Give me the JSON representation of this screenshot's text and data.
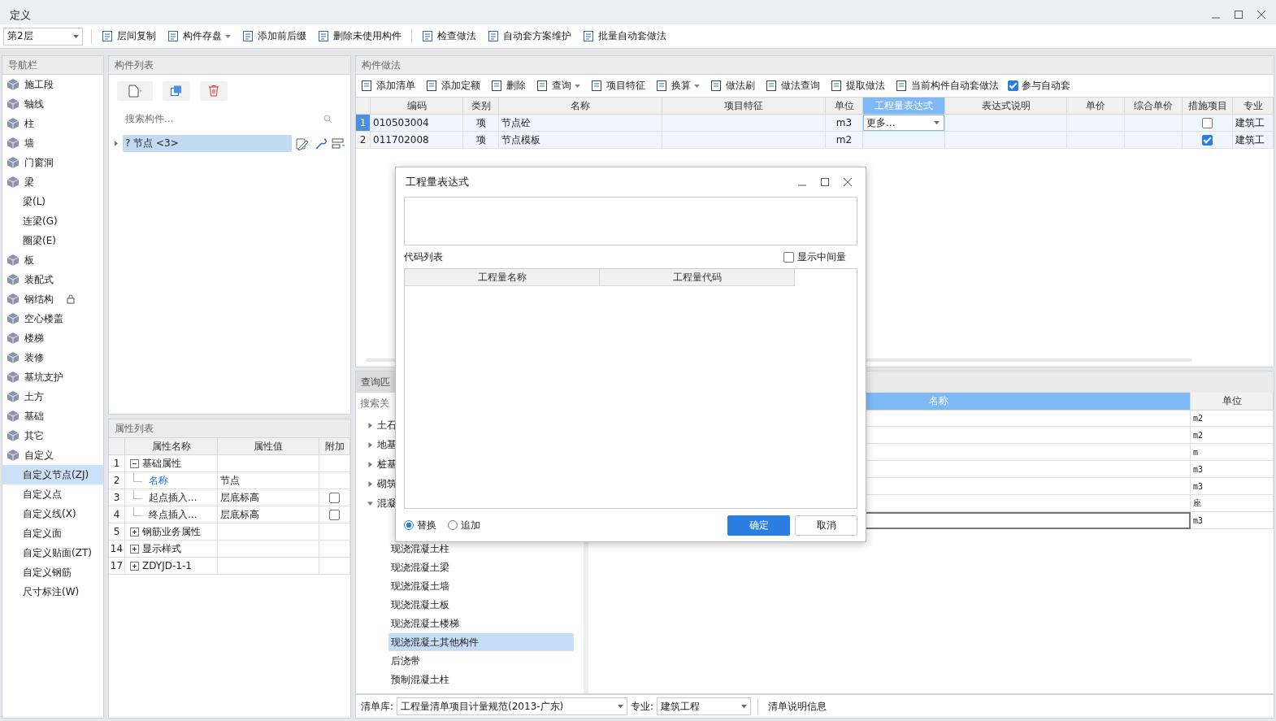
{
  "window": {
    "title": "定义"
  },
  "toolbar": {
    "floor": "第2层",
    "groups": [
      [
        {
          "label": "层间复制",
          "dropdown": false
        },
        {
          "label": "构件存盘",
          "dropdown": true
        },
        {
          "label": "添加前后缀",
          "dropdown": false
        },
        {
          "label": "删除未使用构件",
          "dropdown": false
        }
      ],
      [
        {
          "label": "检查做法",
          "dropdown": false
        },
        {
          "label": "自动套方案维护",
          "dropdown": false
        },
        {
          "label": "批量自动套做法",
          "dropdown": false
        }
      ]
    ]
  },
  "nav": {
    "title": "导航栏",
    "items": [
      {
        "label": "施工段",
        "selected": false,
        "locked": false
      },
      {
        "label": "轴线",
        "selected": false,
        "locked": false
      },
      {
        "label": "柱",
        "selected": false,
        "locked": false
      },
      {
        "label": "墙",
        "selected": false,
        "locked": false
      },
      {
        "label": "门窗洞",
        "selected": false,
        "locked": false
      },
      {
        "label": "梁",
        "selected": false,
        "locked": false,
        "children": [
          {
            "label": "梁(L)",
            "selected": false
          },
          {
            "label": "连梁(G)",
            "selected": false
          },
          {
            "label": "圈梁(E)",
            "selected": false
          }
        ]
      },
      {
        "label": "板",
        "selected": false,
        "locked": false
      },
      {
        "label": "装配式",
        "selected": false,
        "locked": false
      },
      {
        "label": "钢结构",
        "selected": false,
        "locked": true
      },
      {
        "label": "空心楼盖",
        "selected": false,
        "locked": false
      },
      {
        "label": "楼梯",
        "selected": false,
        "locked": false
      },
      {
        "label": "装修",
        "selected": false,
        "locked": false
      },
      {
        "label": "基坑支护",
        "selected": false,
        "locked": false
      },
      {
        "label": "土方",
        "selected": false,
        "locked": false
      },
      {
        "label": "基础",
        "selected": false,
        "locked": false
      },
      {
        "label": "其它",
        "selected": false,
        "locked": false
      },
      {
        "label": "自定义",
        "selected": false,
        "locked": false,
        "children": [
          {
            "label": "自定义节点(ZJ)",
            "selected": true
          },
          {
            "label": "自定义点",
            "selected": false
          },
          {
            "label": "自定义线(X)",
            "selected": false
          },
          {
            "label": "自定义面",
            "selected": false
          },
          {
            "label": "自定义贴面(ZT)",
            "selected": false
          },
          {
            "label": "自定义钢筋",
            "selected": false
          },
          {
            "label": "尺寸标注(W)",
            "selected": false
          }
        ]
      }
    ]
  },
  "component_list": {
    "title": "构件列表",
    "search_placeholder": "搜索构件...",
    "tree": [
      {
        "label": "? 节点 <3>",
        "selected": true,
        "expanded": false
      }
    ]
  },
  "properties": {
    "title": "属性列表",
    "columns": [
      "属性名称",
      "属性值",
      "附加"
    ],
    "rows": [
      {
        "num": "1",
        "kind": "group",
        "name": "基础属性",
        "expanded": true
      },
      {
        "num": "2",
        "kind": "child",
        "name": "名称",
        "value": "节点",
        "highlighted": true
      },
      {
        "num": "3",
        "kind": "child",
        "name": "起点插入...",
        "value": "层底标高",
        "highlighted": false,
        "attached": false
      },
      {
        "num": "4",
        "kind": "child",
        "name": "终点插入...",
        "value": "层底标高",
        "highlighted": false,
        "attached": false
      },
      {
        "num": "5",
        "kind": "group",
        "name": "钢筋业务属性",
        "expanded": false
      },
      {
        "num": "14",
        "kind": "group",
        "name": "显示样式",
        "expanded": false
      },
      {
        "num": "17",
        "kind": "group",
        "name": "ZDYJD-1-1",
        "expanded": false
      }
    ]
  },
  "methods": {
    "title": "构件做法",
    "tools": [
      {
        "label": "添加清单",
        "dropdown": false
      },
      {
        "label": "添加定额",
        "dropdown": false
      },
      {
        "label": "删除",
        "dropdown": false
      },
      {
        "label": "查询",
        "dropdown": true
      },
      {
        "label": "项目特征",
        "dropdown": false
      },
      {
        "label": "换算",
        "dropdown": true
      },
      {
        "label": "做法刷",
        "dropdown": false
      },
      {
        "label": "做法查询",
        "dropdown": false
      },
      {
        "label": "提取做法",
        "dropdown": false
      },
      {
        "label": "当前构件自动套做法",
        "dropdown": false
      }
    ],
    "auto_apply": {
      "label": "参与自动套",
      "checked": true
    },
    "columns": [
      {
        "label": "编码",
        "selected": false
      },
      {
        "label": "类别",
        "selected": false
      },
      {
        "label": "名称",
        "selected": false
      },
      {
        "label": "项目特征",
        "selected": false
      },
      {
        "label": "单位",
        "selected": false
      },
      {
        "label": "工程量表达式",
        "selected": true
      },
      {
        "label": "表达式说明",
        "selected": false
      },
      {
        "label": "单价",
        "selected": false
      },
      {
        "label": "综合单价",
        "selected": false
      },
      {
        "label": "措施项目",
        "selected": false
      },
      {
        "label": "专业",
        "selected": false
      }
    ],
    "rows": [
      {
        "num": "1",
        "code": "010503004",
        "type": "项",
        "name": "节点砼",
        "unit": "m3",
        "expression": "更多...",
        "editing": true,
        "measure": false,
        "specialty": "建筑工",
        "selected": true
      },
      {
        "num": "2",
        "code": "011702008",
        "type": "项",
        "name": "节点模板",
        "unit": "m2",
        "editing": false,
        "measure": true,
        "specialty": "建筑工",
        "selected": false
      }
    ]
  },
  "query": {
    "tab": "查询匹",
    "search_placeholder": "搜索关",
    "tree": [
      {
        "label": "土石",
        "expanded": false
      },
      {
        "label": "地基",
        "expanded": false
      },
      {
        "label": "桩基",
        "expanded": false
      },
      {
        "label": "砌筑",
        "expanded": false
      },
      {
        "label": "混凝",
        "expanded": true,
        "children": [
          {
            "label": "现浇混凝土柱",
            "selected": false
          },
          {
            "label": "现浇混凝土梁",
            "selected": false
          },
          {
            "label": "现浇混凝土墙",
            "selected": false
          },
          {
            "label": "现浇混凝土板",
            "selected": false
          },
          {
            "label": "现浇混凝土楼梯",
            "selected": false
          },
          {
            "label": "现浇混凝土其他构件",
            "selected": true
          },
          {
            "label": "后浇带",
            "selected": false
          },
          {
            "label": "预制混凝土柱",
            "selected": false
          }
        ]
      }
    ],
    "columns": [
      {
        "label": "名称",
        "selected": true
      },
      {
        "label": "单位",
        "selected": false
      }
    ],
    "rows": [
      {
        "unit": "m2",
        "selected": false
      },
      {
        "unit": "m2",
        "selected": false
      },
      {
        "unit": "m",
        "selected": false
      },
      {
        "unit": "m3",
        "selected": false
      },
      {
        "unit": "m3",
        "selected": false
      },
      {
        "unit": "座",
        "selected": false
      },
      {
        "unit": "m3",
        "selected": true
      }
    ],
    "footer": {
      "library_label": "清单库:",
      "library": "工程量清单项目计量规范(2013-广东)",
      "specialty_label": "专业:",
      "specialty": "建筑工程",
      "info_tab": "清单说明信息"
    }
  },
  "dialog": {
    "title": "工程量表达式",
    "code_list_label": "代码列表",
    "show_intermediate": {
      "label": "显示中间量",
      "checked": false
    },
    "columns": [
      "工程量名称",
      "工程量代码"
    ],
    "modes": [
      {
        "label": "替换",
        "selected": true
      },
      {
        "label": "追加",
        "selected": false
      }
    ],
    "buttons": [
      {
        "label": "确定",
        "kind": "primary"
      },
      {
        "label": "取消",
        "kind": "default"
      }
    ]
  }
}
